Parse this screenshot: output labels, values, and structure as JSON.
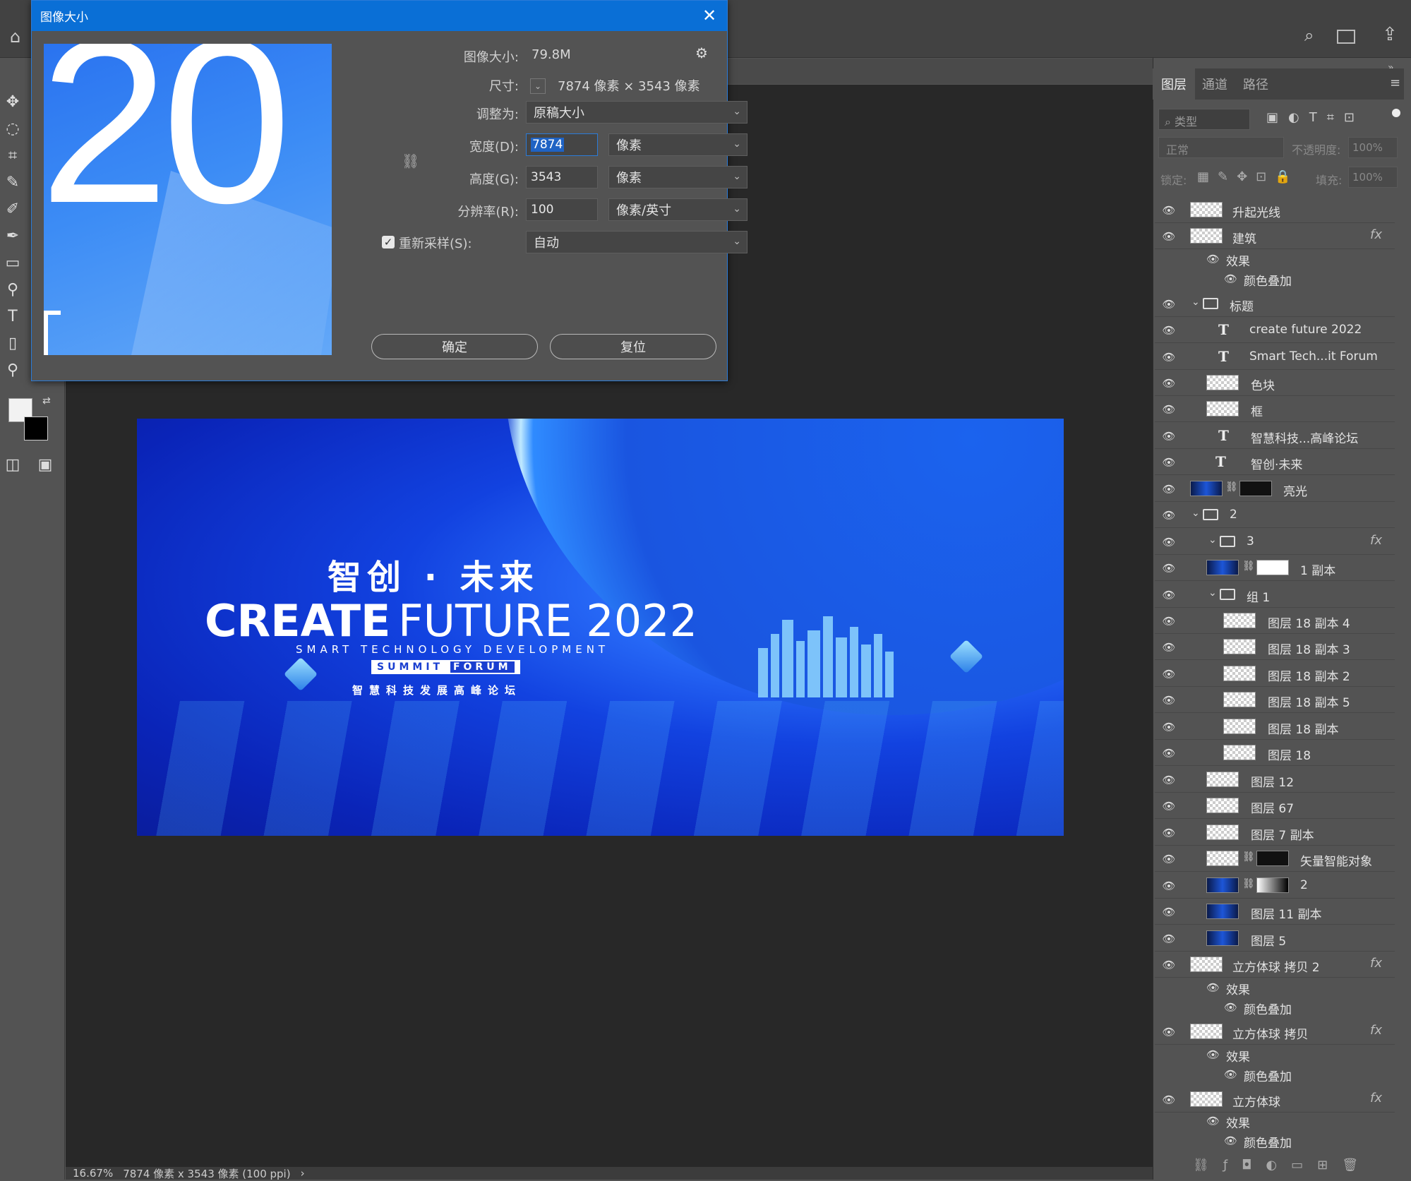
{
  "dialog": {
    "title": "图像大小",
    "close": "✕",
    "image_size_label": "图像大小:",
    "image_size_value": "79.8M",
    "dimensions_label": "尺寸:",
    "dimensions_value": "7874 像素  ×  3543 像素",
    "fit_to_label": "调整为:",
    "fit_to_value": "原稿大小",
    "width_label": "宽度(D):",
    "width_value": "7874",
    "width_unit": "像素",
    "height_label": "高度(G):",
    "height_value": "3543",
    "height_unit": "像素",
    "resolution_label": "分辨率(R):",
    "resolution_value": "100",
    "resolution_unit": "像素/英寸",
    "resample_label": "重新采样(S):",
    "resample_value": "自动",
    "ok_label": "确定",
    "reset_label": "复位",
    "preview_text": "20"
  },
  "artwork": {
    "title_cn": "智创 · 未来",
    "title_en_bold": "CREATE",
    "title_en_light": "FUTURE 2022",
    "subtitle": "SMART TECHNOLOGY DEVELOPMENT",
    "subtitle_box_a": "SUMMIT",
    "subtitle_box_b": "FORUM",
    "subtitle_cn": "智慧科技发展高峰论坛"
  },
  "status": {
    "zoom": "16.67%",
    "info": "7874 像素 x 3543 像素 (100 ppi)",
    "arrow": "›"
  },
  "panel": {
    "tabs": [
      "图层",
      "通道",
      "路径"
    ],
    "filter_placeholder": "类型",
    "blend_mode": "正常",
    "opacity_label": "不透明度:",
    "opacity_value": "100%",
    "lock_label": "锁定:",
    "fill_label": "填充:",
    "fill_value": "100%",
    "layers": [
      {
        "name": "升起光线"
      },
      {
        "name": "建筑",
        "fx": "fx"
      },
      {
        "name": "效果"
      },
      {
        "name": "颜色叠加"
      },
      {
        "name": "标题"
      },
      {
        "name": "create  future 2022"
      },
      {
        "name": "Smart Tech...it Forum"
      },
      {
        "name": "色块"
      },
      {
        "name": "框"
      },
      {
        "name": "智慧科技...高峰论坛"
      },
      {
        "name": "智创·未来"
      },
      {
        "name": "亮光"
      },
      {
        "name": "2"
      },
      {
        "name": "3",
        "fx": "fx"
      },
      {
        "name": "1 副本"
      },
      {
        "name": "组 1"
      },
      {
        "name": "图层 18 副本 4"
      },
      {
        "name": "图层 18 副本 3"
      },
      {
        "name": "图层 18 副本 2"
      },
      {
        "name": "图层 18 副本 5"
      },
      {
        "name": "图层 18 副本"
      },
      {
        "name": "图层 18"
      },
      {
        "name": "图层 12"
      },
      {
        "name": "图层 67"
      },
      {
        "name": "图层 7 副本"
      },
      {
        "name": "矢量智能对象"
      },
      {
        "name": "2"
      },
      {
        "name": "图层 11 副本"
      },
      {
        "name": "图层 5"
      },
      {
        "name": "立方体球 拷贝 2",
        "fx": "fx"
      },
      {
        "name": "效果"
      },
      {
        "name": "颜色叠加"
      },
      {
        "name": "立方体球 拷贝",
        "fx": "fx"
      },
      {
        "name": "效果"
      },
      {
        "name": "颜色叠加"
      },
      {
        "name": "立方体球",
        "fx": "fx"
      },
      {
        "name": "效果"
      },
      {
        "name": "颜色叠加"
      }
    ]
  }
}
